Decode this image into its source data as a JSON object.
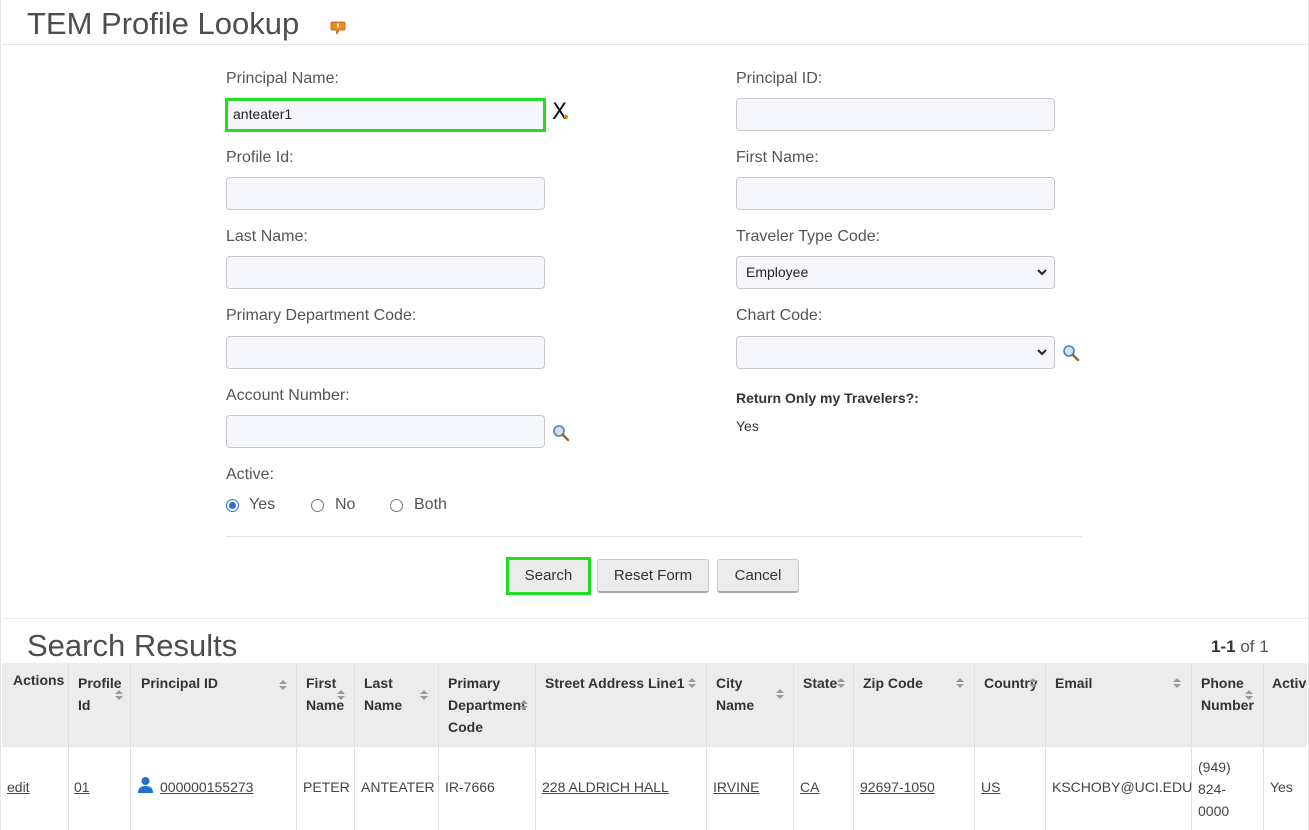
{
  "page": {
    "title": "TEM Profile Lookup"
  },
  "form": {
    "principal_name": {
      "label": "Principal Name:",
      "value": "anteater1",
      "clear": "X"
    },
    "principal_id": {
      "label": "Principal ID:",
      "value": ""
    },
    "profile_id": {
      "label": "Profile Id:",
      "value": ""
    },
    "first_name": {
      "label": "First Name:",
      "value": ""
    },
    "last_name": {
      "label": "Last Name:",
      "value": ""
    },
    "traveler_type_code": {
      "label": "Traveler Type Code:",
      "selected": "Employee"
    },
    "primary_department_code": {
      "label": "Primary Department Code:",
      "value": ""
    },
    "chart_code": {
      "label": "Chart Code:",
      "selected": ""
    },
    "account_number": {
      "label": "Account Number:",
      "value": ""
    },
    "return_only_my_travelers": {
      "label": "Return Only my Travelers?:",
      "value": "Yes"
    },
    "active": {
      "label": "Active:",
      "options": [
        "Yes",
        "No",
        "Both"
      ],
      "selected": "Yes"
    }
  },
  "buttons": {
    "search": "Search",
    "reset": "Reset Form",
    "cancel": "Cancel"
  },
  "results": {
    "title": "Search Results",
    "pager": {
      "range": "1-1",
      "of_text": "of 1"
    },
    "columns": [
      [
        "Actions"
      ],
      [
        "Profile",
        "Id"
      ],
      [
        "Principal ID"
      ],
      [
        "First",
        "Name"
      ],
      [
        "Last",
        "Name"
      ],
      [
        "Primary",
        "Department",
        "Code"
      ],
      [
        "Street Address Line1"
      ],
      [
        "City",
        "Name"
      ],
      [
        "State"
      ],
      [
        "Zip Code"
      ],
      [
        "Country"
      ],
      [
        "Email"
      ],
      [
        "Phone",
        "Number"
      ],
      [
        "Active"
      ]
    ],
    "rows": [
      {
        "action": "edit",
        "profile_id": "01",
        "principal_id": "000000155273",
        "first_name": "PETER",
        "last_name": "ANTEATER",
        "dept_code": "IR-7666",
        "street": "228 ALDRICH HALL",
        "city": "IRVINE",
        "state": "CA",
        "zip": "92697-1050",
        "country": "US",
        "email": "KSCHOBY@UCI.EDU",
        "phone": [
          "(949)",
          "824-",
          "0000"
        ],
        "active": "Yes"
      }
    ]
  },
  "icons": {
    "title_icon": "info-bubble-icon",
    "lookup": "magnifier-icon",
    "person": "person-icon",
    "accent": "#22dd22",
    "link_blue": "#2b6fd6"
  }
}
